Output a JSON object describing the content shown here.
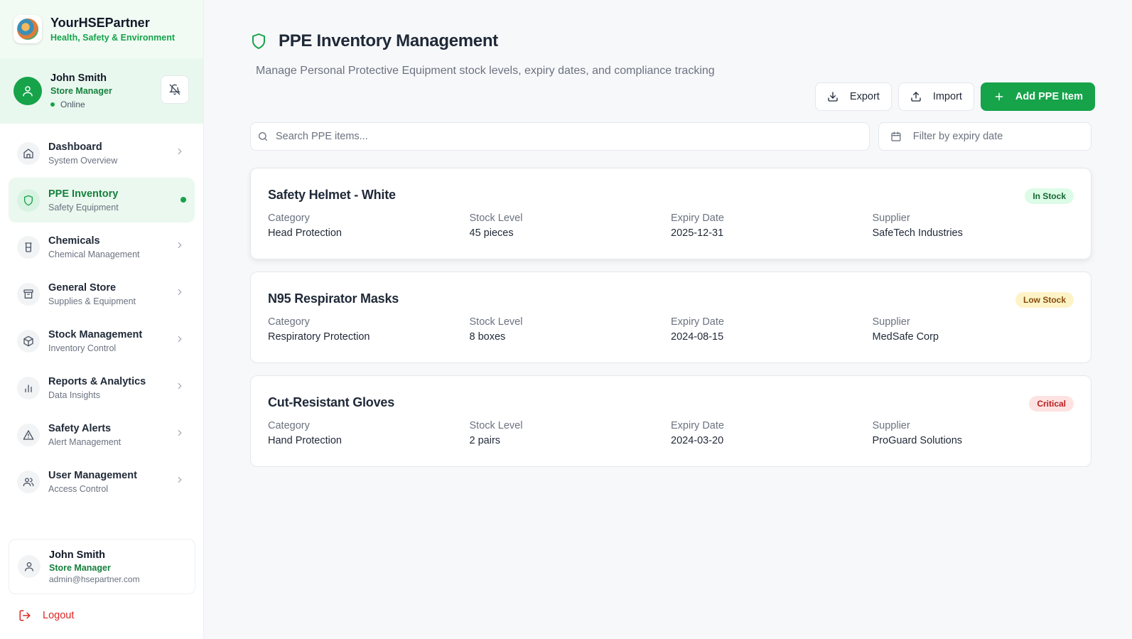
{
  "brand": {
    "title": "YourHSEPartner",
    "subtitle": "Health, Safety & Environment"
  },
  "current_user": {
    "name": "John Smith",
    "role": "Store Manager",
    "status": "Online",
    "email": "admin@hsepartner.com"
  },
  "sidebar": {
    "items": [
      {
        "label": "Dashboard",
        "sub": "System Overview",
        "icon": "home-icon"
      },
      {
        "label": "PPE Inventory",
        "sub": "Safety Equipment",
        "icon": "shield-icon",
        "active": true
      },
      {
        "label": "Chemicals",
        "sub": "Chemical Management",
        "icon": "beaker-icon"
      },
      {
        "label": "General Store",
        "sub": "Supplies & Equipment",
        "icon": "archive-icon"
      },
      {
        "label": "Stock Management",
        "sub": "Inventory Control",
        "icon": "package-icon"
      },
      {
        "label": "Reports & Analytics",
        "sub": "Data Insights",
        "icon": "bar-chart-icon"
      },
      {
        "label": "Safety Alerts",
        "sub": "Alert Management",
        "icon": "alert-triangle-icon"
      },
      {
        "label": "User Management",
        "sub": "Access Control",
        "icon": "users-icon"
      }
    ],
    "logout_label": "Logout"
  },
  "page": {
    "title": "PPE Inventory Management",
    "description": "Manage Personal Protective Equipment stock levels, expiry dates, and compliance tracking"
  },
  "toolbar": {
    "export_label": "Export",
    "import_label": "Import",
    "add_label": "Add PPE Item"
  },
  "search": {
    "placeholder": "Search PPE items..."
  },
  "filter": {
    "placeholder": "Filter by expiry date"
  },
  "field_labels": {
    "category": "Category",
    "stock": "Stock Level",
    "expiry": "Expiry Date",
    "supplier": "Supplier"
  },
  "items": [
    {
      "name": "Safety Helmet - White",
      "status": "In Stock",
      "status_color": "#dcfce7",
      "category": "Head Protection",
      "stock": "45 pieces",
      "expiry": "2025-12-31",
      "supplier": "SafeTech Industries"
    },
    {
      "name": "N95 Respirator Masks",
      "status": "Low Stock",
      "status_color": "#fef3c7",
      "category": "Respiratory Protection",
      "stock": "8 boxes",
      "expiry": "2024-08-15",
      "supplier": "MedSafe Corp"
    },
    {
      "name": "Cut-Resistant Gloves",
      "status": "Critical",
      "status_color": "#fee2e2",
      "category": "Hand Protection",
      "stock": "2 pairs",
      "expiry": "2024-03-20",
      "supplier": "ProGuard Solutions"
    }
  ],
  "colors": {
    "accent": "#16a34a",
    "danger": "#dc2626"
  }
}
